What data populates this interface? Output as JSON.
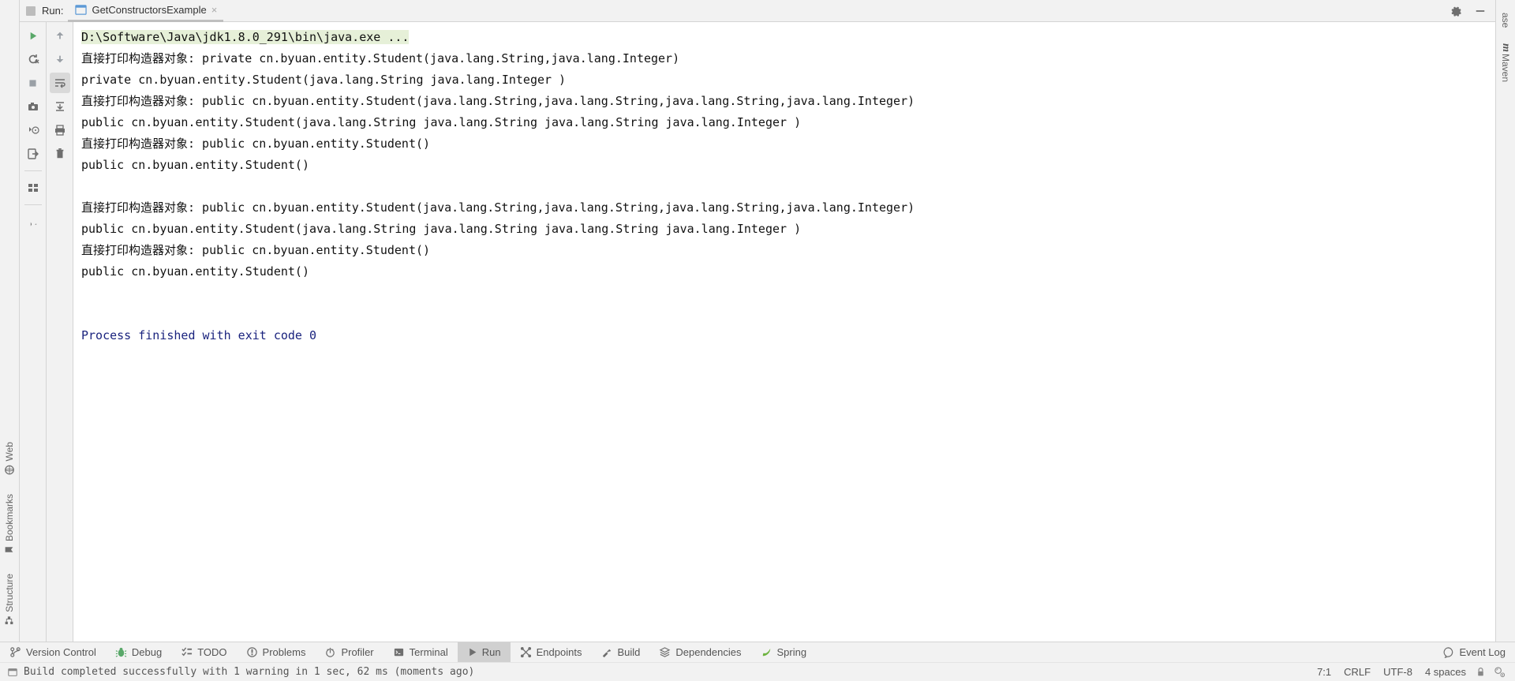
{
  "leftStripe": {
    "structure": "Structure",
    "bookmarks": "Bookmarks",
    "web": "Web"
  },
  "rightStripe": {
    "database": "ase",
    "maven": "Maven"
  },
  "runHeader": {
    "label": "Run:",
    "tabName": "GetConstructorsExample"
  },
  "console": {
    "cmdLine": "D:\\Software\\Java\\jdk1.8.0_291\\bin\\java.exe ...",
    "lines": [
      "直接打印构造器对象: private cn.byuan.entity.Student(java.lang.String,java.lang.Integer)",
      "private cn.byuan.entity.Student(java.lang.String java.lang.Integer )",
      "直接打印构造器对象: public cn.byuan.entity.Student(java.lang.String,java.lang.String,java.lang.String,java.lang.Integer)",
      "public cn.byuan.entity.Student(java.lang.String java.lang.String java.lang.String java.lang.Integer )",
      "直接打印构造器对象: public cn.byuan.entity.Student()",
      "public cn.byuan.entity.Student()",
      "",
      "直接打印构造器对象: public cn.byuan.entity.Student(java.lang.String,java.lang.String,java.lang.String,java.lang.Integer)",
      "public cn.byuan.entity.Student(java.lang.String java.lang.String java.lang.String java.lang.Integer )",
      "直接打印构造器对象: public cn.byuan.entity.Student()",
      "public cn.byuan.entity.Student()",
      "",
      ""
    ],
    "exitLine": "Process finished with exit code 0"
  },
  "bottomBar": {
    "buttons": [
      {
        "label": "Version Control",
        "icon": "branch-icon"
      },
      {
        "label": "Debug",
        "icon": "bug-icon"
      },
      {
        "label": "TODO",
        "icon": "todo-icon"
      },
      {
        "label": "Problems",
        "icon": "problems-icon"
      },
      {
        "label": "Profiler",
        "icon": "profiler-icon"
      },
      {
        "label": "Terminal",
        "icon": "terminal-icon"
      },
      {
        "label": "Run",
        "icon": "play-icon",
        "active": true
      },
      {
        "label": "Endpoints",
        "icon": "endpoints-icon"
      },
      {
        "label": "Build",
        "icon": "hammer-icon"
      },
      {
        "label": "Dependencies",
        "icon": "layers-icon"
      },
      {
        "label": "Spring",
        "icon": "spring-icon"
      }
    ],
    "eventLog": "Event Log"
  },
  "statusBar": {
    "message": "Build completed successfully with 1 warning in 1 sec, 62 ms (moments ago)",
    "pos": "7:1",
    "lineSep": "CRLF",
    "encoding": "UTF-8",
    "indent": "4 spaces"
  }
}
